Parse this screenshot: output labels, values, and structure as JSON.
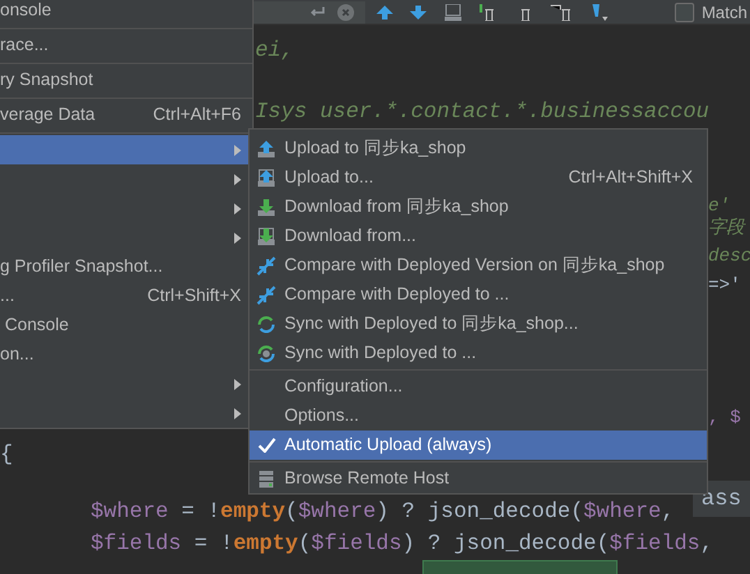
{
  "toolbar": {
    "match_checkbox": {
      "label": "Match",
      "checked": false
    }
  },
  "editor": {
    "lines": [
      {
        "tokens": [
          {
            "kind": "string",
            "text": "ei,"
          }
        ]
      },
      {
        "tokens": [
          {
            "kind": "string",
            "text": "Isys user.*.contact.*.businessaccou"
          }
        ]
      },
      {
        "tokens": [
          {
            "kind": "brace",
            "text": "{"
          }
        ]
      },
      {
        "tokens": [
          {
            "kind": "var",
            "text": "$where"
          },
          {
            "kind": "plain",
            "text": " = !"
          },
          {
            "kind": "keyword",
            "text": "empty"
          },
          {
            "kind": "plain",
            "text": "("
          },
          {
            "kind": "var",
            "text": "$where"
          },
          {
            "kind": "plain",
            "text": ") ? json_decode("
          },
          {
            "kind": "var",
            "text": "$where"
          },
          {
            "kind": "plain",
            "text": ","
          }
        ]
      },
      {
        "tokens": [
          {
            "kind": "var",
            "text": "$fields"
          },
          {
            "kind": "plain",
            "text": " = !"
          },
          {
            "kind": "keyword",
            "text": "empty"
          },
          {
            "kind": "plain",
            "text": "("
          },
          {
            "kind": "var",
            "text": "$fields"
          },
          {
            "kind": "plain",
            "text": ") ? json_decode("
          },
          {
            "kind": "var",
            "text": "$fields"
          },
          {
            "kind": "plain",
            "text": ","
          }
        ]
      }
    ],
    "fragments": [
      {
        "kind": "string",
        "text": "e'"
      },
      {
        "kind": "string",
        "text": "字段"
      },
      {
        "kind": "string",
        "text": "desc"
      },
      {
        "kind": "plain",
        "text": "=>'"
      },
      {
        "kind": "var",
        "text": ", $"
      }
    ],
    "hint": "ass"
  },
  "main_menu": {
    "items": [
      {
        "kind": "item",
        "label": "onsole",
        "selected": false,
        "submenu": false
      },
      {
        "kind": "separator"
      },
      {
        "kind": "item",
        "label": "race...",
        "selected": false,
        "submenu": false
      },
      {
        "kind": "separator"
      },
      {
        "kind": "item",
        "label": "ry Snapshot",
        "selected": false,
        "submenu": false
      },
      {
        "kind": "separator"
      },
      {
        "kind": "item",
        "label": "verage Data",
        "shortcut": "Ctrl+Alt+F6",
        "selected": false,
        "submenu": false
      },
      {
        "kind": "separator"
      },
      {
        "kind": "item",
        "selected": true,
        "submenu": true
      },
      {
        "kind": "item",
        "selected": false,
        "submenu": true
      },
      {
        "kind": "item",
        "selected": false,
        "submenu": true
      },
      {
        "kind": "item",
        "selected": false,
        "submenu": true
      },
      {
        "kind": "item",
        "label": "g Profiler Snapshot...",
        "selected": false,
        "submenu": false
      },
      {
        "kind": "item",
        "label": "...",
        "shortcut": "Ctrl+Shift+X",
        "selected": false,
        "submenu": false
      },
      {
        "kind": "item",
        "label": " Console",
        "selected": false,
        "submenu": false
      },
      {
        "kind": "item",
        "label": "on...",
        "selected": false,
        "submenu": false
      },
      {
        "kind": "item",
        "selected": false,
        "submenu": true
      },
      {
        "kind": "item",
        "selected": false,
        "submenu": true
      }
    ]
  },
  "deployment_menu": {
    "items": [
      {
        "kind": "item",
        "label": "Upload to 同步ka_shop",
        "selected": false
      },
      {
        "kind": "item",
        "label": "Upload to...",
        "shortcut": "Ctrl+Alt+Shift+X",
        "selected": false
      },
      {
        "kind": "item",
        "label": "Download from 同步ka_shop",
        "selected": false
      },
      {
        "kind": "item",
        "label": "Download from...",
        "selected": false
      },
      {
        "kind": "item",
        "label": "Compare with Deployed Version on 同步ka_shop",
        "selected": false
      },
      {
        "kind": "item",
        "label": "Compare with Deployed to ...",
        "selected": false
      },
      {
        "kind": "item",
        "label": "Sync with Deployed to 同步ka_shop...",
        "selected": false
      },
      {
        "kind": "item",
        "label": "Sync with Deployed to ...",
        "selected": false
      },
      {
        "kind": "separator"
      },
      {
        "kind": "item",
        "label": "Configuration...",
        "selected": false
      },
      {
        "kind": "item",
        "label": "Options...",
        "selected": false
      },
      {
        "kind": "item",
        "label": "Automatic Upload (always)",
        "checked": true,
        "selected": true
      },
      {
        "kind": "separator"
      },
      {
        "kind": "item",
        "label": "Browse Remote Host",
        "selected": false
      }
    ]
  }
}
